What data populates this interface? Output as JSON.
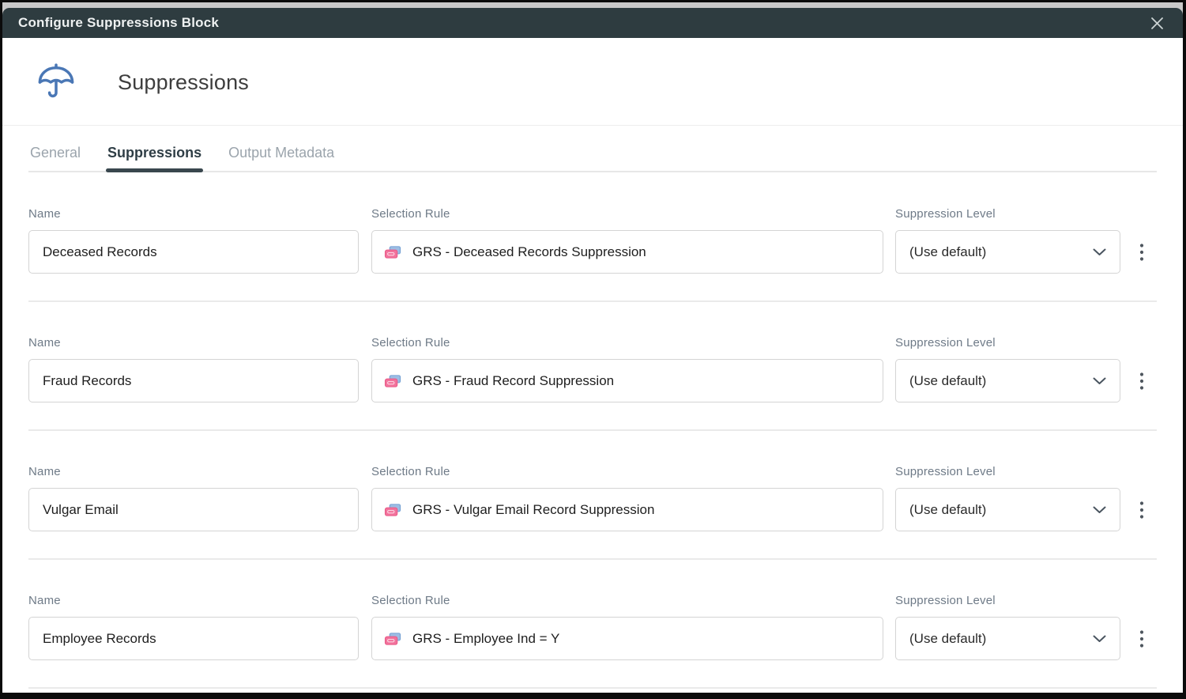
{
  "window": {
    "title": "Configure Suppressions Block"
  },
  "header": {
    "title": "Suppressions",
    "icon": "umbrella-icon"
  },
  "tabs": [
    {
      "label": "General",
      "active": false
    },
    {
      "label": "Suppressions",
      "active": true
    },
    {
      "label": "Output Metadata",
      "active": false
    }
  ],
  "labels": {
    "name": "Name",
    "selection_rule": "Selection Rule",
    "suppression_level": "Suppression Level"
  },
  "rows": [
    {
      "name": "Deceased Records",
      "selection_rule": "GRS - Deceased Records Suppression",
      "suppression_level": "(Use default)"
    },
    {
      "name": "Fraud Records",
      "selection_rule": "GRS - Fraud Record Suppression",
      "suppression_level": "(Use default)"
    },
    {
      "name": "Vulgar Email",
      "selection_rule": "GRS - Vulgar Email Record Suppression",
      "suppression_level": "(Use default)"
    },
    {
      "name": "Employee Records",
      "selection_rule": "GRS - Employee Ind = Y",
      "suppression_level": "(Use default)"
    }
  ],
  "icons": {
    "close": "close-icon",
    "rule": "rule-cards-icon",
    "chevron": "chevron-down-icon",
    "kebab": "kebab-menu-icon"
  },
  "colors": {
    "titlebar_bg": "#2e3c40",
    "titlebar_text": "#eef1f1",
    "backdrop_strip": "#c9c9c9",
    "umbrella_blue": "#4a77b5",
    "active_tab": "#2f3e46",
    "inactive_tab": "#9ba4ac",
    "tab_underline": "#39474e",
    "field_border": "#d4d4d4",
    "label_text": "#6e7a87",
    "rule_icon_pink": "#f2729c",
    "rule_icon_blue": "#9dbde4"
  }
}
